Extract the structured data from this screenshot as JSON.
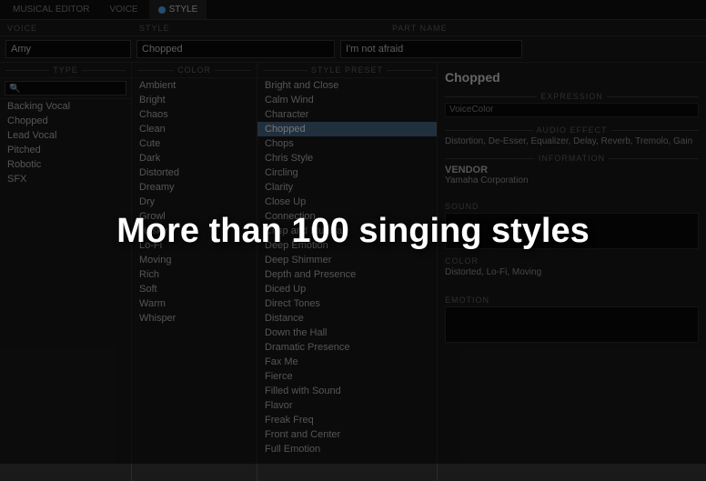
{
  "tabs": [
    {
      "label": "MUSICAL EDITOR",
      "active": false
    },
    {
      "label": "VOICE",
      "active": false
    },
    {
      "label": "STYLE",
      "active": true,
      "dot": true
    }
  ],
  "section_headers": {
    "voice": "VOICE",
    "style": "STYLE",
    "part_name": "PART NAME"
  },
  "inputs": {
    "voice": {
      "value": "Amy",
      "placeholder": "Amy"
    },
    "style": {
      "value": "Chopped",
      "placeholder": "Chopped"
    },
    "part_name": {
      "value": "I'm not afraid",
      "placeholder": "I'm not afraid"
    }
  },
  "type_panel": {
    "header": "TYPE",
    "search_placeholder": "",
    "items": [
      {
        "label": "Backing Vocal",
        "selected": false
      },
      {
        "label": "Chopped",
        "selected": false
      },
      {
        "label": "Lead Vocal",
        "selected": false
      },
      {
        "label": "Pitched",
        "selected": false
      },
      {
        "label": "Robotic",
        "selected": false
      },
      {
        "label": "SFX",
        "selected": false
      }
    ]
  },
  "color_panel": {
    "header": "COLOR",
    "items": [
      {
        "label": "Ambient"
      },
      {
        "label": "Bright"
      },
      {
        "label": "Chaos"
      },
      {
        "label": "Clean"
      },
      {
        "label": "Cute"
      },
      {
        "label": "Dark"
      },
      {
        "label": "Distorted"
      },
      {
        "label": "Dreamy"
      },
      {
        "label": "Dry"
      },
      {
        "label": "Growl"
      },
      {
        "label": "Husky"
      },
      {
        "label": "Lo-Fi"
      },
      {
        "label": "Moving"
      },
      {
        "label": "Rich"
      },
      {
        "label": "Soft"
      },
      {
        "label": "Warm"
      },
      {
        "label": "Whisper"
      }
    ]
  },
  "style_panel": {
    "header": "STYLE PRESET",
    "items": [
      {
        "label": "Bright and Close"
      },
      {
        "label": "Calm Wind"
      },
      {
        "label": "Character"
      },
      {
        "label": "Chopped",
        "selected": true
      },
      {
        "label": "Chops"
      },
      {
        "label": "Chris Style"
      },
      {
        "label": "Circling"
      },
      {
        "label": "Clarity"
      },
      {
        "label": "Close Up"
      },
      {
        "label": "Connection"
      },
      {
        "label": "Crisp and Musical"
      },
      {
        "label": "Deep Emotion"
      },
      {
        "label": "Deep Shimmer"
      },
      {
        "label": "Depth and Presence"
      },
      {
        "label": "Diced Up"
      },
      {
        "label": "Direct Tones"
      },
      {
        "label": "Distance"
      },
      {
        "label": "Down the Hall"
      },
      {
        "label": "Dramatic Presence"
      },
      {
        "label": "Fax Me"
      },
      {
        "label": "Fierce"
      },
      {
        "label": "Filled with Sound"
      },
      {
        "label": "Flavor"
      },
      {
        "label": "Freak Freq"
      },
      {
        "label": "Front and Center"
      },
      {
        "label": "Full Emotion"
      }
    ]
  },
  "info_panel": {
    "title": "Chopped",
    "expression_label": "EXPRESSION",
    "expression_value": "VoiceColor",
    "audio_effect_label": "AUDIO EFFECT",
    "audio_effect_value": "Distortion, De-Esser, Equalizer, Delay, Reverb, Tremolo, Gain",
    "information_label": "INFORMATION",
    "vendor_label": "VENDOR",
    "vendor_value": "Yamaha Corporation",
    "color_label": "COLOR",
    "color_value": "Distorted, Lo-Fi, Moving",
    "sound_label": "Sound",
    "emotion_label": "Emotion"
  },
  "overlay": {
    "text": "More than 100 singing styles"
  }
}
